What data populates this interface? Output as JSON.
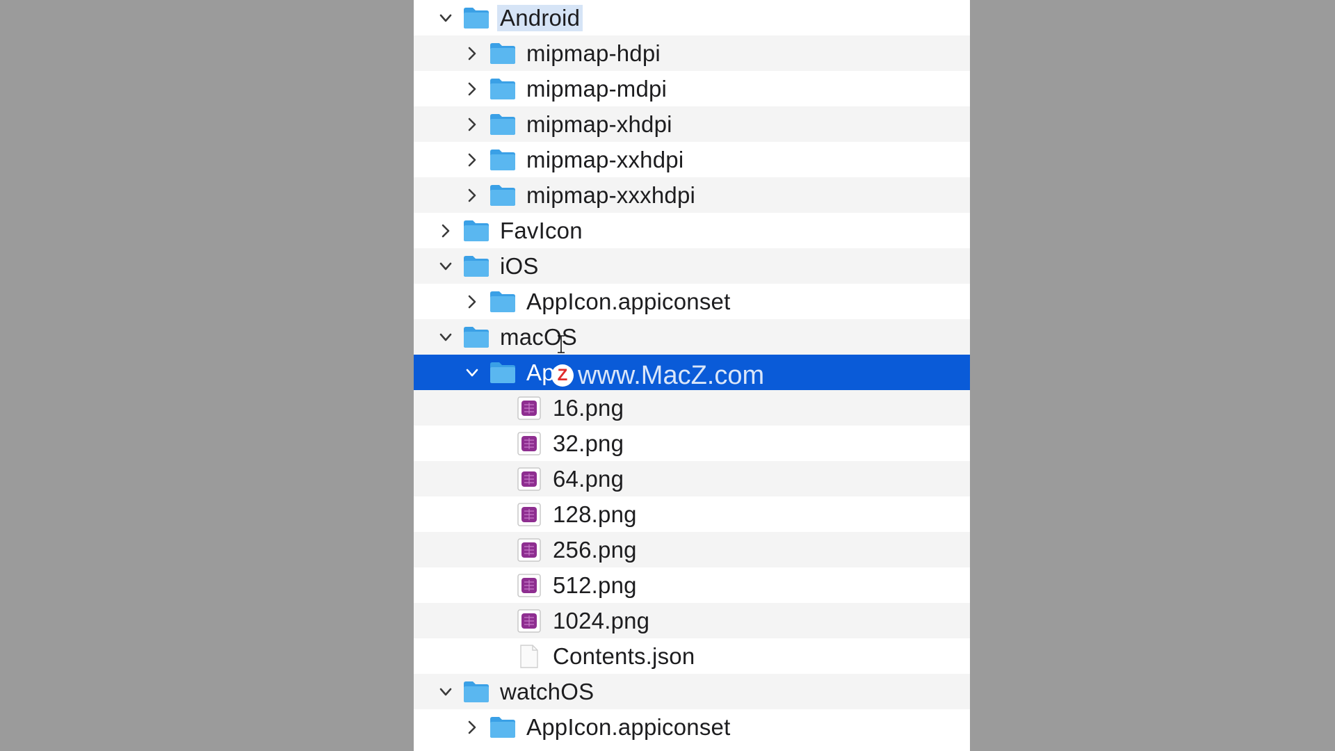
{
  "colors": {
    "background": "#9b9b9b",
    "selection": "#0a5bd8",
    "folder_blue": "#5ab7f0",
    "image_icon_purple": "#8e2e90"
  },
  "tree": [
    {
      "label": "Android",
      "icon": "folder-icon",
      "chevron": "down",
      "level": 0,
      "highlighted": true
    },
    {
      "label": "mipmap-hdpi",
      "icon": "folder-icon",
      "chevron": "right",
      "level": 1
    },
    {
      "label": "mipmap-mdpi",
      "icon": "folder-icon",
      "chevron": "right",
      "level": 1
    },
    {
      "label": "mipmap-xhdpi",
      "icon": "folder-icon",
      "chevron": "right",
      "level": 1
    },
    {
      "label": "mipmap-xxhdpi",
      "icon": "folder-icon",
      "chevron": "right",
      "level": 1
    },
    {
      "label": "mipmap-xxxhdpi",
      "icon": "folder-icon",
      "chevron": "right",
      "level": 1
    },
    {
      "label": "FavIcon",
      "icon": "folder-icon",
      "chevron": "right",
      "level": 0
    },
    {
      "label": "iOS",
      "icon": "folder-icon",
      "chevron": "down",
      "level": 0
    },
    {
      "label": "AppIcon.appiconset",
      "icon": "folder-icon",
      "chevron": "right",
      "level": 1
    },
    {
      "label": "macOS",
      "icon": "folder-icon",
      "chevron": "down",
      "level": 0
    },
    {
      "label": "Ap",
      "icon": "folder-icon",
      "chevron": "down",
      "level": 1,
      "selected": true
    },
    {
      "label": "16.png",
      "icon": "png-image-icon",
      "chevron": "none",
      "level": 2
    },
    {
      "label": "32.png",
      "icon": "png-image-icon",
      "chevron": "none",
      "level": 2
    },
    {
      "label": "64.png",
      "icon": "png-image-icon",
      "chevron": "none",
      "level": 2
    },
    {
      "label": "128.png",
      "icon": "png-image-icon",
      "chevron": "none",
      "level": 2
    },
    {
      "label": "256.png",
      "icon": "png-image-icon",
      "chevron": "none",
      "level": 2
    },
    {
      "label": "512.png",
      "icon": "png-image-icon",
      "chevron": "none",
      "level": 2
    },
    {
      "label": "1024.png",
      "icon": "png-image-icon",
      "chevron": "none",
      "level": 2
    },
    {
      "label": "Contents.json",
      "icon": "json-file-icon",
      "chevron": "none",
      "level": 2
    },
    {
      "label": "watchOS",
      "icon": "folder-icon",
      "chevron": "down",
      "level": 0
    },
    {
      "label": "AppIcon.appiconset",
      "icon": "folder-icon",
      "chevron": "right",
      "level": 1
    }
  ],
  "watermark": {
    "badge": "Z",
    "text": "www.MacZ.com"
  }
}
